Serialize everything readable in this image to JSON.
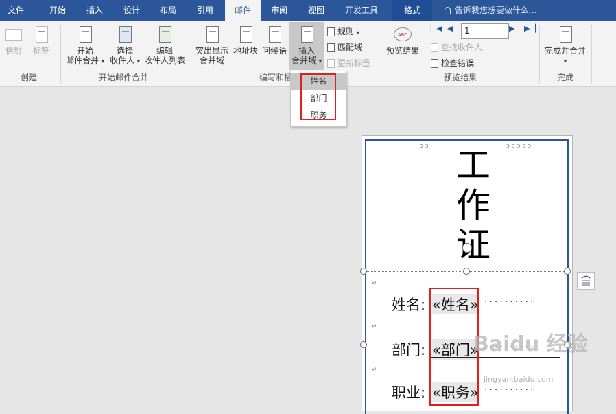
{
  "tabs": [
    "文件",
    "开始",
    "插入",
    "设计",
    "布局",
    "引用",
    "邮件",
    "审阅",
    "视图",
    "开发工具",
    "格式"
  ],
  "tell_me": "告诉我您想要做什么...",
  "ribbon": {
    "envelope": "信封",
    "labels": "标签",
    "start_merge_l1": "开始",
    "start_merge_l2": "邮件合并",
    "select_recipients_l1": "选择",
    "select_recipients_l2": "收件人",
    "edit_list_l1": "编辑",
    "edit_list_l2": "收件人列表",
    "highlight_l1": "突出显示",
    "highlight_l2": "合并域",
    "address_block": "地址块",
    "greeting": "问候语",
    "insert_field_l1": "插入",
    "insert_field_l2": "合并域",
    "rules": "规则",
    "match_fields": "匹配域",
    "update_labels": "更新标签",
    "preview_results": "预览结果",
    "record_number": "1",
    "find_recipient": "查找收件人",
    "check_errors": "检查错误",
    "finish_merge": "完成并合并",
    "groups": {
      "create": "创建",
      "start_merge": "开始邮件合并",
      "write_insert": "编写和插",
      "preview": "预览结果",
      "finish": "完成"
    }
  },
  "dropdown_items": [
    "姓名",
    "部门",
    "职务"
  ],
  "document": {
    "title_chars": [
      "工",
      "作",
      "证"
    ],
    "rows": [
      {
        "label": "姓名:",
        "field": "«姓名»"
      },
      {
        "label": "部门:",
        "field": "«部门»"
      },
      {
        "label": "职业:",
        "field": "«职务»"
      }
    ]
  },
  "watermark": {
    "main": "Baidu 经验",
    "sub": "jingyan.baidu.com"
  },
  "colors": {
    "ribbon_blue": "#2b579a",
    "highlight_red": "#e02020"
  }
}
